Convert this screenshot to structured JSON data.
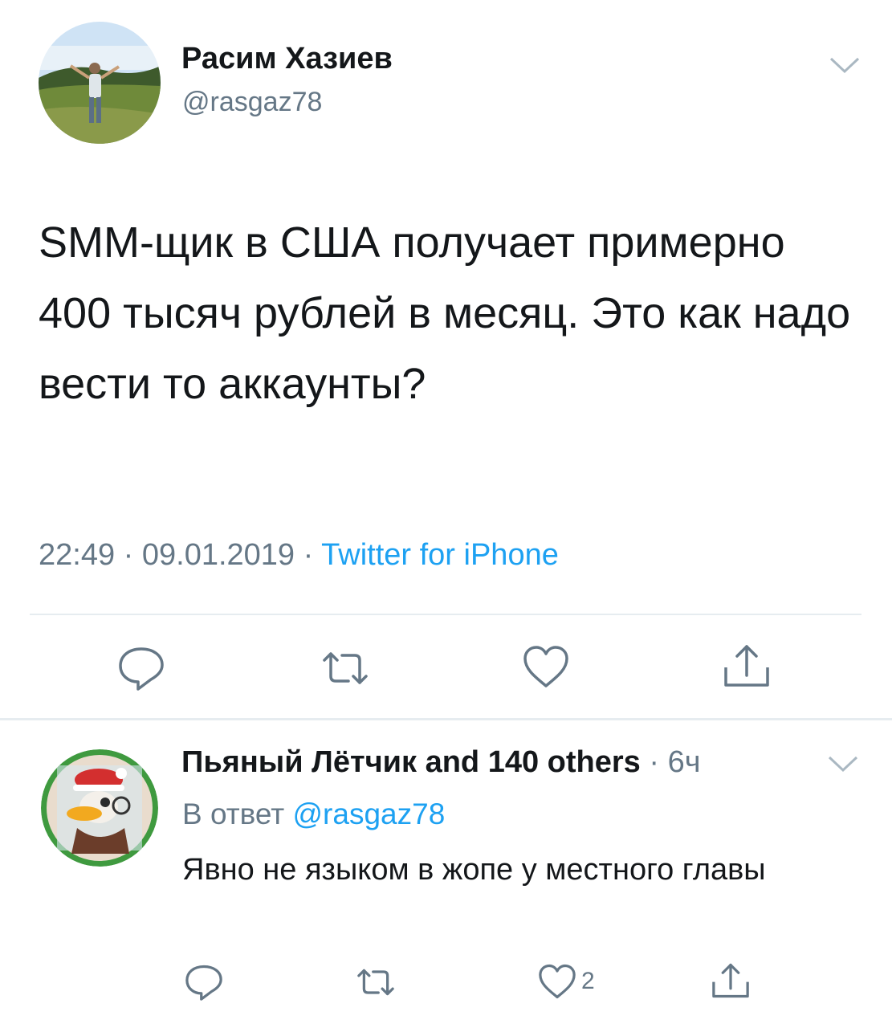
{
  "tweet": {
    "author_name": "Расим Хазиев",
    "author_handle": "@rasgaz78",
    "text": "SMM-щик в США получает примерно 400 тысяч рублей в месяц. Это как надо вести то аккаунты?",
    "time": "22:49",
    "date": "09.01.2019",
    "source": "Twitter for iPhone",
    "separator": "·",
    "actions": [
      "reply-icon",
      "retweet-icon",
      "like-icon",
      "share-icon"
    ]
  },
  "reply": {
    "author_name": "Пьяный Лётчик and 140 others",
    "time": "6ч",
    "separator": "·",
    "in_reply_prefix": "В ответ",
    "in_reply_handle": "@rasgaz78",
    "text": "Явно не языком в жопе у местного главы",
    "like_count": "2",
    "actions": [
      "reply-icon",
      "retweet-icon",
      "like-icon",
      "share-icon"
    ]
  },
  "colors": {
    "text": "#14171a",
    "secondary": "#657786",
    "link": "#1da1f2",
    "divider": "#e6ecf0"
  }
}
